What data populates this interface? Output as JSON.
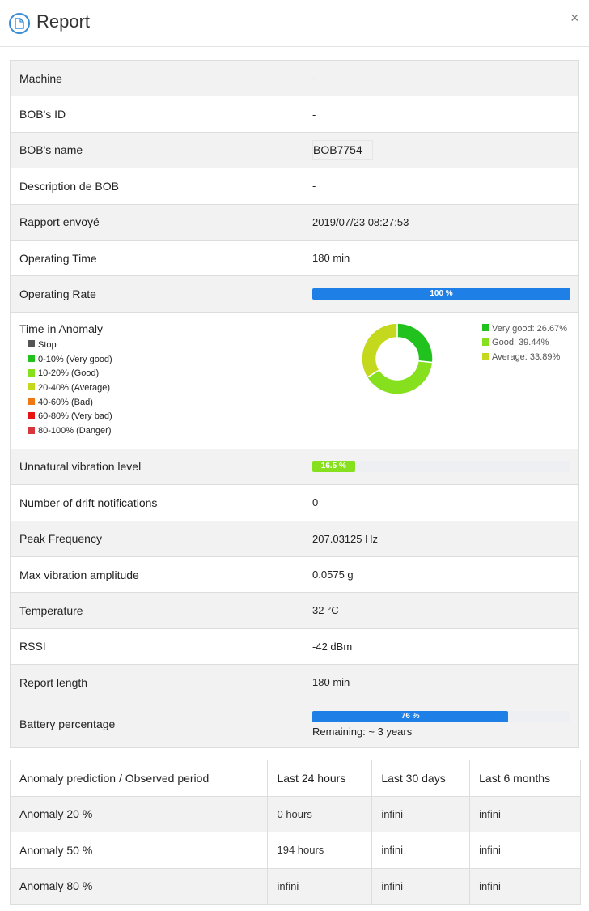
{
  "header": {
    "title": "Report",
    "close": "×"
  },
  "report": {
    "machine": {
      "label": "Machine",
      "value": "-"
    },
    "bob_id": {
      "label": "BOB's ID",
      "value": "-"
    },
    "bob_name": {
      "label": "BOB's name",
      "value": "BOB7754"
    },
    "description": {
      "label": "Description de BOB",
      "value": "-"
    },
    "sent": {
      "label": "Rapport envoyé",
      "value": "2019/07/23 08:27:53"
    },
    "operating_time": {
      "label": "Operating Time",
      "value": "180 min"
    },
    "operating_rate": {
      "label": "Operating Rate",
      "percent": 100,
      "text": "100 %",
      "color": "#1e7fe6"
    },
    "anomaly": {
      "label": "Time in Anomaly",
      "legend": [
        {
          "label": "Stop",
          "color": "#555555"
        },
        {
          "label": "0-10% (Very good)",
          "color": "#22c21e"
        },
        {
          "label": "10-20% (Good)",
          "color": "#86e01e"
        },
        {
          "label": "20-40% (Average)",
          "color": "#c4d81e"
        },
        {
          "label": "40-60% (Bad)",
          "color": "#f07814"
        },
        {
          "label": "60-80% (Very bad)",
          "color": "#e81414"
        },
        {
          "label": "80-100% (Danger)",
          "color": "#d8343c"
        }
      ]
    },
    "unnatural_vibration": {
      "label": "Unnatural vibration level",
      "percent": 16.5,
      "text": "16.5 %",
      "color": "#86e01e"
    },
    "drift": {
      "label": "Number of drift notifications",
      "value": "0"
    },
    "peak_frequency": {
      "label": "Peak Frequency",
      "value": "207.03125 Hz"
    },
    "max_amplitude": {
      "label": "Max vibration amplitude",
      "value": "0.0575 g"
    },
    "temperature": {
      "label": "Temperature",
      "value": "32 °C"
    },
    "rssi": {
      "label": "RSSI",
      "value": "-42 dBm"
    },
    "report_length": {
      "label": "Report length",
      "value": "180 min"
    },
    "battery": {
      "label": "Battery percentage",
      "percent": 76,
      "text": "76 %",
      "color": "#1e7fe6",
      "remaining": "Remaining: ~ 3 years"
    }
  },
  "chart_data": {
    "type": "pie",
    "categories": [
      "Very good",
      "Good",
      "Average"
    ],
    "values": [
      26.67,
      39.44,
      33.89
    ],
    "colors": [
      "#22c21e",
      "#86e01e",
      "#c4d81e"
    ],
    "legend_labels": [
      "Very good: 26.67%",
      "Good: 39.44%",
      "Average: 33.89%"
    ],
    "legend_position": "right"
  },
  "prediction": {
    "headers": [
      "Anomaly prediction / Observed period",
      "Last 24 hours",
      "Last 30 days",
      "Last 6 months"
    ],
    "rows": [
      [
        "Anomaly 20 %",
        "0 hours",
        "infini",
        "infini"
      ],
      [
        "Anomaly 50 %",
        "194 hours",
        "infini",
        "infini"
      ],
      [
        "Anomaly 80 %",
        "infini",
        "infini",
        "infini"
      ]
    ]
  }
}
